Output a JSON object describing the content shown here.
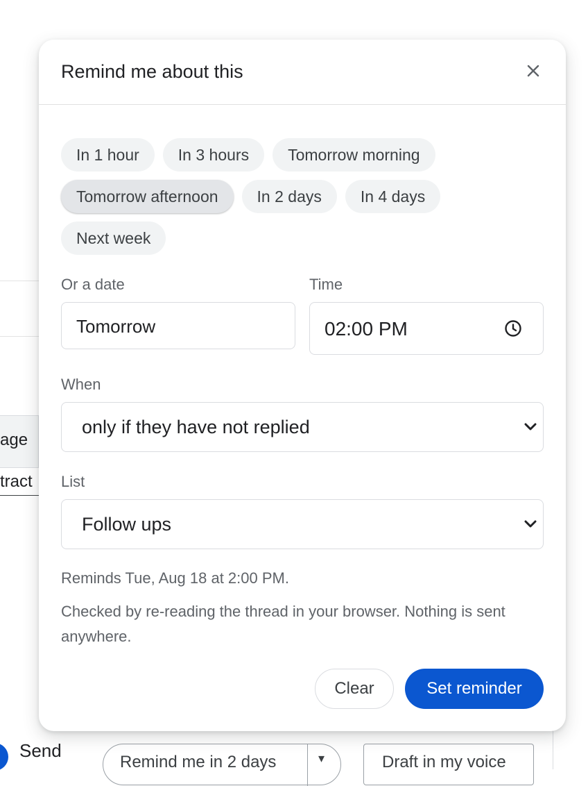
{
  "background": {
    "panel_text": "age",
    "row_text": "tract",
    "send_label": "Send",
    "remind_split_label": "Remind me in 2 days",
    "remind_split_caret": "▾",
    "draft_label": "Draft in my voice"
  },
  "dialog": {
    "title": "Remind me about this",
    "close_glyph": "✕",
    "chips": [
      {
        "label": "In 1 hour",
        "selected": false
      },
      {
        "label": "In 3 hours",
        "selected": false
      },
      {
        "label": "Tomorrow morning",
        "selected": false
      },
      {
        "label": "Tomorrow afternoon",
        "selected": true
      },
      {
        "label": "In 2 days",
        "selected": false
      },
      {
        "label": "In 4 days",
        "selected": false
      },
      {
        "label": "Next week",
        "selected": false
      }
    ],
    "date": {
      "label": "Or a date",
      "value": "Tomorrow"
    },
    "time": {
      "label": "Time",
      "value": "02:00 PM"
    },
    "when": {
      "label": "When",
      "value": "only if they have not replied"
    },
    "list": {
      "label": "List",
      "value": "Follow ups"
    },
    "reminds_text": "Reminds Tue, Aug 18 at 2:00 PM.",
    "note_text": "Checked by re-reading the thread in your browser. Nothing is sent anywhere.",
    "clear_label": "Clear",
    "set_label": "Set reminder"
  },
  "colors": {
    "primary": "#0b57d0",
    "chip_bg": "#f1f3f4",
    "muted_text": "#5f6368"
  }
}
